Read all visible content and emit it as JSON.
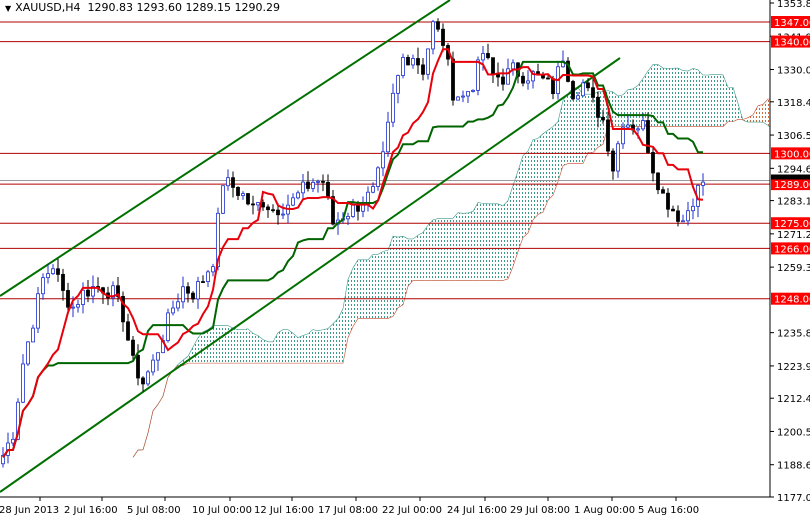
{
  "header": {
    "symbol": "XAUUSD,H4",
    "open": "1290.83",
    "high": "1293.60",
    "low": "1289.15",
    "close": "1290.29",
    "menu_icon": "triangle-down-icon"
  },
  "colors": {
    "bull": "#1c2fcf",
    "bear": "#000000",
    "tenkan": "#e8000b",
    "kijun": "#006400",
    "level": "#b00000",
    "label_bg": "#ff0000",
    "trend": "#007000"
  },
  "chart_data": {
    "type": "candlestick",
    "symbol": "XAUUSD",
    "timeframe": "H4",
    "ylim": [
      1177.05,
      1353.8
    ],
    "y_ticks": [
      "1353.80",
      "1341.90",
      "1330.00",
      "1318.45",
      "1306.55",
      "1294.65",
      "1283.10",
      "1271.20",
      "1259.30",
      "1235.85",
      "1223.95",
      "1212.40",
      "1200.50",
      "1188.60",
      "1177.05"
    ],
    "x_ticks": [
      "28 Jun 2013",
      "2 Jul 16:00",
      "5 Jul 08:00",
      "10 Jul 00:00",
      "12 Jul 16:00",
      "17 Jul 08:00",
      "22 Jul 00:00",
      "24 Jul 16:00",
      "29 Jul 08:00",
      "1 Aug 00:00",
      "5 Aug 16:00"
    ],
    "levels": [
      "1347.00",
      "1340.00",
      "1300.00",
      "1289.00",
      "1275.00",
      "1266.00",
      "1248.00"
    ],
    "current_price": "1290.29",
    "closes_approx": [
      1192,
      1200,
      1225,
      1240,
      1255,
      1260,
      1250,
      1245,
      1250,
      1252,
      1252,
      1250,
      1242,
      1225,
      1218,
      1225,
      1235,
      1245,
      1252,
      1250,
      1255,
      1262,
      1290,
      1288,
      1285,
      1280,
      1283,
      1280,
      1281,
      1283,
      1287,
      1290,
      1290,
      1275,
      1278,
      1280,
      1283,
      1286,
      1298,
      1320,
      1334,
      1335,
      1330,
      1346,
      1340,
      1322,
      1320,
      1325,
      1336,
      1328,
      1327,
      1330,
      1328,
      1328,
      1326,
      1323,
      1335,
      1322,
      1325,
      1318,
      1312,
      1295,
      1312,
      1310,
      1310,
      1295,
      1285,
      1280,
      1276,
      1284,
      1290
    ],
    "indicators": [
      "Ichimoku Tenkan-sen",
      "Ichimoku Kijun-sen",
      "Ichimoku Cloud",
      "Trend channel"
    ]
  }
}
